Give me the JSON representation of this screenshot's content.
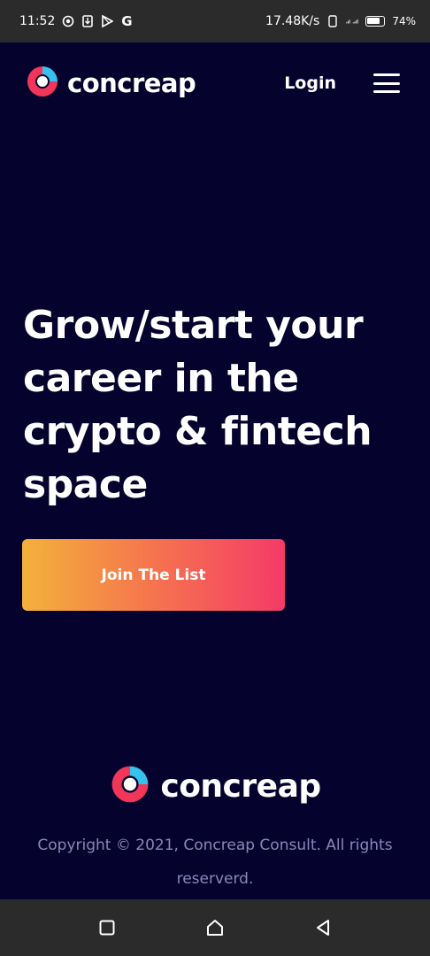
{
  "status_bar": {
    "time": "11:52",
    "net_speed": "17.48K/s",
    "battery": "74%"
  },
  "header": {
    "brand_name": "concreap",
    "login_label": "Login",
    "menu_icon": "hamburger-menu-icon"
  },
  "hero": {
    "title": "Grow/start your career in the crypto & fintech space",
    "cta_label": "Join The List"
  },
  "footer": {
    "brand_name": "concreap",
    "copyright": "Copyright © 2021, Concreap Consult. All rights reserverd."
  },
  "colors": {
    "background": "#05032e",
    "gradient_start": "#f4b13b",
    "gradient_end": "#f53a68",
    "logo_red": "#f2365a",
    "logo_blue": "#35c3ee",
    "copyright_text": "#8a87b8"
  },
  "system_nav": {
    "recent_icon": "square-icon",
    "home_icon": "home-icon",
    "back_icon": "back-triangle-icon"
  }
}
